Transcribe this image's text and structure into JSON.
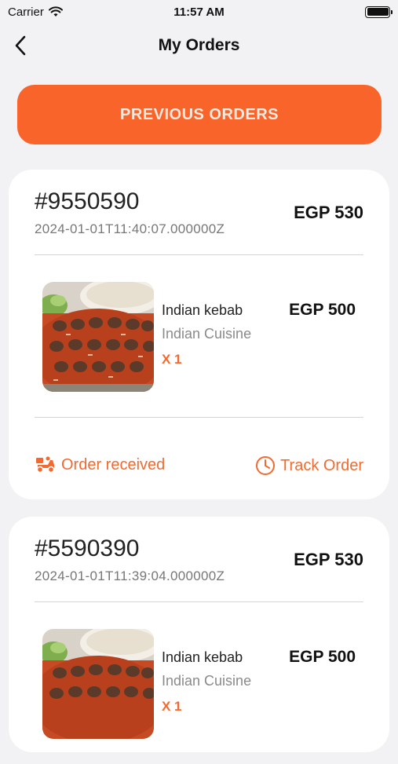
{
  "status_bar": {
    "carrier": "Carrier",
    "time": "11:57 AM"
  },
  "header": {
    "title": "My Orders"
  },
  "previous_orders_label": "PREVIOUS ORDERS",
  "colors": {
    "accent": "#f9642a",
    "accent_text": "#f26a2f",
    "background": "#f2f2f4",
    "card": "#ffffff"
  },
  "orders": [
    {
      "id": "#9550590",
      "date": "2024-01-01T11:40:07.000000Z",
      "total": "EGP 530",
      "item": {
        "name": "Indian kebab",
        "cuisine": "Indian Cuisine",
        "qty": "X 1",
        "price": "EGP 500"
      },
      "status_label": "Order received",
      "status_icon": "delivery-scooter-icon",
      "track_label": "Track Order",
      "track_icon": "clock-icon"
    },
    {
      "id": "#5590390",
      "date": "2024-01-01T11:39:04.000000Z",
      "total": "EGP 530",
      "item": {
        "name": "Indian kebab",
        "cuisine": "Indian Cuisine",
        "qty": "X 1",
        "price": "EGP 500"
      }
    }
  ]
}
